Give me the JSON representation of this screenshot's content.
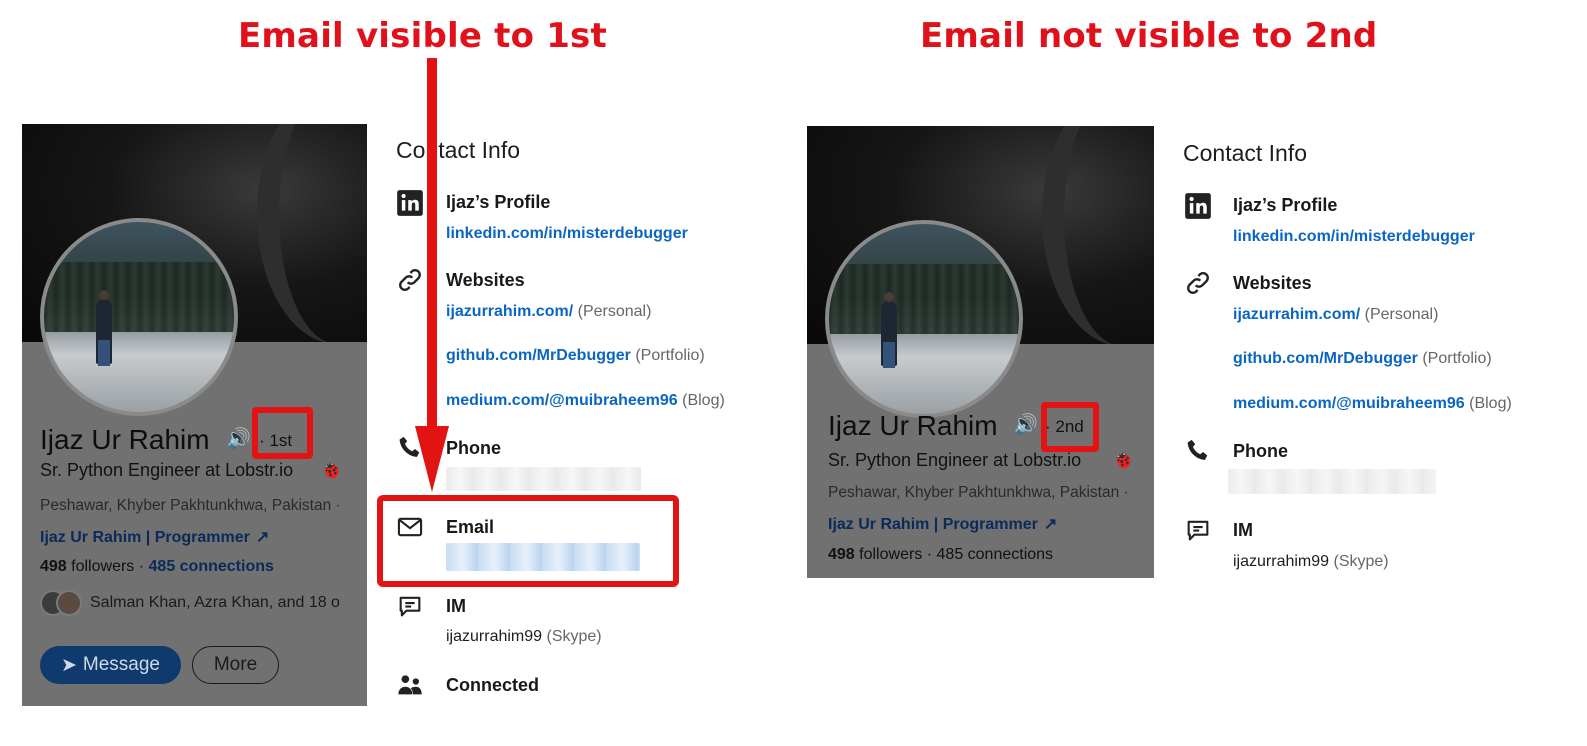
{
  "captions": {
    "left": "Email visible to 1st",
    "right": "Email not visible to 2nd"
  },
  "colors": {
    "annotation_red": "#e31313",
    "link_blue": "#0a66c2"
  },
  "left_profile": {
    "name": "Ijaz Ur Rahim",
    "degree": "1st",
    "headline": "Sr. Python Engineer at Lobstr.io",
    "location": "Peshawar, Khyber Pakhtunkhwa, Pakistan ·",
    "website_link": "Ijaz Ur Rahim | Programmer",
    "followers": "498",
    "followers_label": "followers",
    "connections": "485 connections",
    "mutual": "Salman Khan, Azra Khan, and 18 o",
    "message_button": "Message",
    "more_button": "More"
  },
  "right_profile": {
    "name": "Ijaz Ur Rahim",
    "degree": "2nd",
    "headline": "Sr. Python Engineer at Lobstr.io",
    "location": "Peshawar, Khyber Pakhtunkhwa, Pakistan ·",
    "website_link": "Ijaz Ur Rahim | Programmer",
    "followers": "498",
    "followers_label": "followers",
    "connections": "485 connections"
  },
  "left_contact": {
    "title": "Contact Info",
    "profile_label": "Ijaz’s Profile",
    "profile_url": "linkedin.com/in/misterdebugger",
    "websites_label": "Websites",
    "sites": [
      {
        "url": "ijazurrahim.com/",
        "note": "(Personal)"
      },
      {
        "url": "github.com/MrDebugger",
        "note": "(Portfolio)"
      },
      {
        "url": "medium.com/@muibraheem96",
        "note": "(Blog)"
      }
    ],
    "phone_label": "Phone",
    "email_label": "Email",
    "im_label": "IM",
    "im_value": "ijazurrahim99",
    "im_note": "(Skype)",
    "connected_label": "Connected"
  },
  "right_contact": {
    "title": "Contact Info",
    "profile_label": "Ijaz’s Profile",
    "profile_url": "linkedin.com/in/misterdebugger",
    "websites_label": "Websites",
    "sites": [
      {
        "url": "ijazurrahim.com/",
        "note": "(Personal)"
      },
      {
        "url": "github.com/MrDebugger",
        "note": "(Portfolio)"
      },
      {
        "url": "medium.com/@muibraheem96",
        "note": "(Blog)"
      }
    ],
    "phone_label": "Phone",
    "im_label": "IM",
    "im_value": "ijazurrahim99",
    "im_note": "(Skype)"
  },
  "icons": {
    "linkedin": "linkedin-icon",
    "link": "link-icon",
    "phone": "phone-icon",
    "email": "envelope-icon",
    "im": "chat-bubble-icon",
    "connected": "people-icon",
    "speaker": "speaker-icon",
    "external": "external-link-icon",
    "send": "send-icon"
  }
}
